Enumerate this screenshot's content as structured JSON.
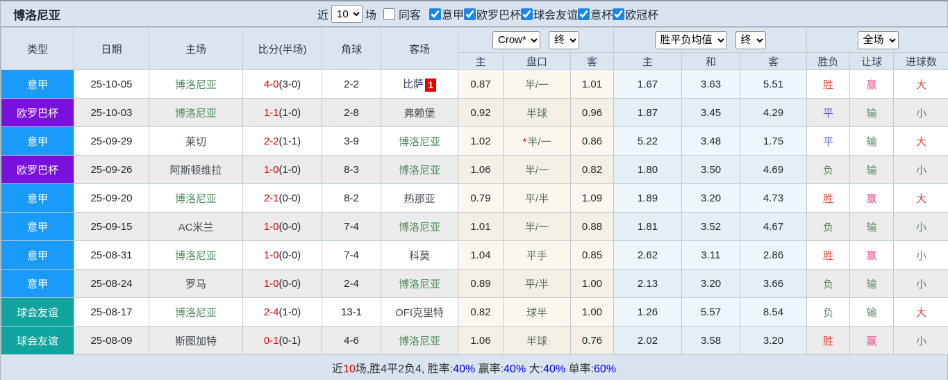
{
  "title": "博洛尼亚",
  "topbar": {
    "recent_label": "近",
    "recent_value": "10",
    "matches_label": "场",
    "same_away": {
      "label": "同客",
      "checked": false
    },
    "filters": [
      {
        "label": "意甲",
        "checked": true
      },
      {
        "label": "欧罗巴杯",
        "checked": true
      },
      {
        "label": "球会友谊",
        "checked": true
      },
      {
        "label": "意杯",
        "checked": true
      },
      {
        "label": "欧冠杯",
        "checked": true
      }
    ]
  },
  "table": {
    "col_headers": {
      "type": "类型",
      "date": "日期",
      "home": "主场",
      "score": "比分(半场)",
      "corners": "角球",
      "away": "客场",
      "odds_home": "主",
      "odds_handicap": "盘口",
      "odds_away": "客",
      "avg_home": "主",
      "avg_draw": "和",
      "avg_away": "客",
      "result_wdl": "胜负",
      "result_handicap": "让球",
      "result_goals": "进球数"
    },
    "dropdowns": {
      "company": "Crow*",
      "company_time": "终",
      "avg": "胜平负均值",
      "avg_time": "终",
      "scope": "全场"
    },
    "rows": [
      {
        "league": "意甲",
        "date": "25-10-05",
        "home": {
          "name": "博洛尼亚",
          "self": true
        },
        "score": "4-0",
        "half": "(3-0)",
        "corners": "2-2",
        "away": {
          "name": "比萨",
          "link": true,
          "badge": "1"
        },
        "odds": {
          "home": "0.87",
          "handicap": "半/一",
          "away": "1.01",
          "star": false
        },
        "avg": {
          "home": "1.67",
          "draw": "3.63",
          "away": "5.51"
        },
        "results": {
          "wdl": {
            "text": "胜",
            "color": "red"
          },
          "handicap": {
            "text": "赢",
            "color": "pink"
          },
          "goals": {
            "text": "大",
            "color": "red"
          }
        }
      },
      {
        "league": "欧罗巴杯",
        "date": "25-10-03",
        "home": {
          "name": "博洛尼亚",
          "self": true
        },
        "score": "1-1",
        "half": "(1-0)",
        "corners": "2-8",
        "away": {
          "name": "弗赖堡"
        },
        "odds": {
          "home": "0.92",
          "handicap": "半球",
          "away": "0.96",
          "star": false
        },
        "avg": {
          "home": "1.87",
          "draw": "3.45",
          "away": "4.29"
        },
        "results": {
          "wdl": {
            "text": "平",
            "color": "blue"
          },
          "handicap": {
            "text": "输",
            "color": "green"
          },
          "goals": {
            "text": "小",
            "color": "green"
          }
        }
      },
      {
        "league": "意甲",
        "date": "25-09-29",
        "home": {
          "name": "莱切"
        },
        "score": "2-2",
        "half": "(1-1)",
        "corners": "3-9",
        "away": {
          "name": "博洛尼亚",
          "self": true
        },
        "odds": {
          "home": "1.02",
          "handicap": "半/一",
          "away": "0.86",
          "star": true
        },
        "avg": {
          "home": "5.22",
          "draw": "3.48",
          "away": "1.75"
        },
        "results": {
          "wdl": {
            "text": "平",
            "color": "blue"
          },
          "handicap": {
            "text": "输",
            "color": "green"
          },
          "goals": {
            "text": "大",
            "color": "red"
          }
        }
      },
      {
        "league": "欧罗巴杯",
        "date": "25-09-26",
        "home": {
          "name": "阿斯顿维拉"
        },
        "score": "1-0",
        "half": "(1-0)",
        "corners": "8-3",
        "away": {
          "name": "博洛尼亚",
          "self": true
        },
        "odds": {
          "home": "1.06",
          "handicap": "半/一",
          "away": "0.82",
          "star": false
        },
        "avg": {
          "home": "1.80",
          "draw": "3.50",
          "away": "4.69"
        },
        "results": {
          "wdl": {
            "text": "负",
            "color": "green"
          },
          "handicap": {
            "text": "输",
            "color": "green"
          },
          "goals": {
            "text": "小",
            "color": "green"
          }
        }
      },
      {
        "league": "意甲",
        "date": "25-09-20",
        "home": {
          "name": "博洛尼亚",
          "self": true
        },
        "score": "2-1",
        "half": "(0-0)",
        "corners": "8-2",
        "away": {
          "name": "热那亚"
        },
        "odds": {
          "home": "0.79",
          "handicap": "平/半",
          "away": "1.09",
          "star": false
        },
        "avg": {
          "home": "1.89",
          "draw": "3.20",
          "away": "4.73"
        },
        "results": {
          "wdl": {
            "text": "胜",
            "color": "red"
          },
          "handicap": {
            "text": "赢",
            "color": "pink"
          },
          "goals": {
            "text": "大",
            "color": "red"
          }
        }
      },
      {
        "league": "意甲",
        "date": "25-09-15",
        "home": {
          "name": "AC米兰"
        },
        "score": "1-0",
        "half": "(0-0)",
        "corners": "7-4",
        "away": {
          "name": "博洛尼亚",
          "self": true
        },
        "odds": {
          "home": "1.01",
          "handicap": "半/一",
          "away": "0.88",
          "star": false
        },
        "avg": {
          "home": "1.81",
          "draw": "3.52",
          "away": "4.67"
        },
        "results": {
          "wdl": {
            "text": "负",
            "color": "green"
          },
          "handicap": {
            "text": "输",
            "color": "green"
          },
          "goals": {
            "text": "小",
            "color": "green"
          }
        }
      },
      {
        "league": "意甲",
        "date": "25-08-31",
        "home": {
          "name": "博洛尼亚",
          "self": true
        },
        "score": "1-0",
        "half": "(0-0)",
        "corners": "7-4",
        "away": {
          "name": "科莫"
        },
        "odds": {
          "home": "1.04",
          "handicap": "平手",
          "away": "0.85",
          "star": false
        },
        "avg": {
          "home": "2.62",
          "draw": "3.11",
          "away": "2.86"
        },
        "results": {
          "wdl": {
            "text": "胜",
            "color": "red"
          },
          "handicap": {
            "text": "赢",
            "color": "pink"
          },
          "goals": {
            "text": "小",
            "color": "green"
          }
        }
      },
      {
        "league": "意甲",
        "date": "25-08-24",
        "home": {
          "name": "罗马"
        },
        "score": "1-0",
        "half": "(0-0)",
        "corners": "2-4",
        "away": {
          "name": "博洛尼亚",
          "self": true
        },
        "odds": {
          "home": "0.89",
          "handicap": "平/半",
          "away": "1.00",
          "star": false
        },
        "avg": {
          "home": "2.13",
          "draw": "3.20",
          "away": "3.66"
        },
        "results": {
          "wdl": {
            "text": "负",
            "color": "green"
          },
          "handicap": {
            "text": "输",
            "color": "green"
          },
          "goals": {
            "text": "小",
            "color": "green"
          }
        }
      },
      {
        "league": "球会友谊",
        "date": "25-08-17",
        "home": {
          "name": "博洛尼亚",
          "self": true
        },
        "score": "2-4",
        "half": "(1-0)",
        "corners": "13-1",
        "away": {
          "name": "OFI克里特"
        },
        "odds": {
          "home": "0.82",
          "handicap": "球半",
          "away": "1.00",
          "star": false
        },
        "avg": {
          "home": "1.26",
          "draw": "5.57",
          "away": "8.54"
        },
        "results": {
          "wdl": {
            "text": "负",
            "color": "green"
          },
          "handicap": {
            "text": "输",
            "color": "green"
          },
          "goals": {
            "text": "大",
            "color": "red"
          }
        }
      },
      {
        "league": "球会友谊",
        "date": "25-08-09",
        "home": {
          "name": "斯图加特"
        },
        "score": "0-1",
        "half": "(0-1)",
        "corners": "4-6",
        "away": {
          "name": "博洛尼亚",
          "self": true
        },
        "odds": {
          "home": "1.06",
          "handicap": "半球",
          "away": "0.76",
          "star": false
        },
        "avg": {
          "home": "2.02",
          "draw": "3.58",
          "away": "3.20"
        },
        "results": {
          "wdl": {
            "text": "胜",
            "color": "red"
          },
          "handicap": {
            "text": "赢",
            "color": "pink"
          },
          "goals": {
            "text": "小",
            "color": "green"
          }
        }
      }
    ]
  },
  "summary_segments": [
    {
      "text": "近",
      "color": "dark"
    },
    {
      "text": "10",
      "color": "red"
    },
    {
      "text": "场,胜4平2负4, 胜率:",
      "color": "dark"
    },
    {
      "text": "40%",
      "color": "blue"
    },
    {
      "text": " 赢率:",
      "color": "dark"
    },
    {
      "text": "40%",
      "color": "blue"
    },
    {
      "text": " 大:",
      "color": "dark"
    },
    {
      "text": "40%",
      "color": "blue"
    },
    {
      "text": " 单率:",
      "color": "dark"
    },
    {
      "text": "60%",
      "color": "blue"
    }
  ],
  "colors": {
    "league": {
      "意甲": "#189bfa",
      "欧罗巴杯": "#7a10dd",
      "球会友谊": "#10a49e"
    },
    "team_self": "#4e8d5b",
    "team_opponent": "#464d55",
    "team_link": "#2c3e6e",
    "score": "#e80000",
    "result": {
      "red": "#e0493b",
      "pink": "#f2548c",
      "green": "#5d8a62",
      "blue": "#5b5bd9"
    },
    "summary_number": "#0000ee",
    "summary_red": "#e80000",
    "summary_dark": "#333333",
    "badge": "#e80000"
  }
}
